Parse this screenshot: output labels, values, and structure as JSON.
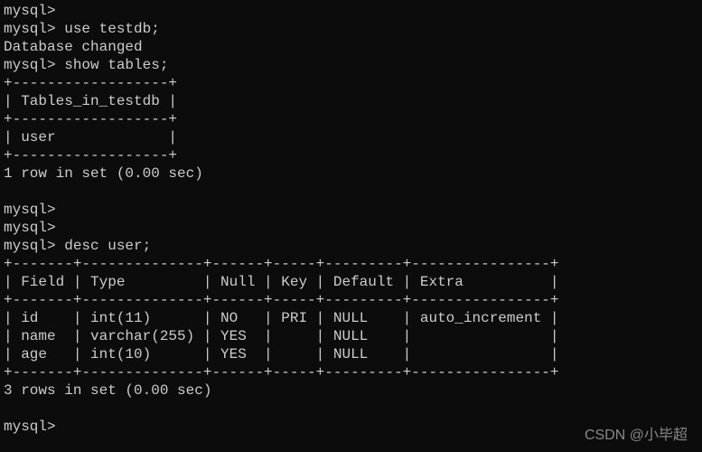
{
  "prompt": "mysql>",
  "commands": {
    "use_db": "use testdb;",
    "show_tables": "show tables;",
    "desc_user": "desc user;"
  },
  "messages": {
    "db_changed": "Database changed",
    "one_row": "1 row in set (0.00 sec)",
    "three_rows": "3 rows in set (0.00 sec)"
  },
  "tables_result": {
    "border_top": "+------------------+",
    "header": "| Tables_in_testdb |",
    "border_mid": "+------------------+",
    "row": "| user             |",
    "border_bot": "+------------------+"
  },
  "desc_result": {
    "border": "+-------+--------------+------+-----+---------+----------------+",
    "header": "| Field | Type         | Null | Key | Default | Extra          |",
    "row1": "| id    | int(11)      | NO   | PRI | NULL    | auto_increment |",
    "row2": "| name  | varchar(255) | YES  |     | NULL    |                |",
    "row3": "| age   | int(10)      | YES  |     | NULL    |                |"
  },
  "watermark": "CSDN @小毕超",
  "chart_data": {
    "type": "table",
    "tables_in_testdb": [
      "user"
    ],
    "desc_user": {
      "columns": [
        "Field",
        "Type",
        "Null",
        "Key",
        "Default",
        "Extra"
      ],
      "rows": [
        {
          "Field": "id",
          "Type": "int(11)",
          "Null": "NO",
          "Key": "PRI",
          "Default": "NULL",
          "Extra": "auto_increment"
        },
        {
          "Field": "name",
          "Type": "varchar(255)",
          "Null": "YES",
          "Key": "",
          "Default": "NULL",
          "Extra": ""
        },
        {
          "Field": "age",
          "Type": "int(10)",
          "Null": "YES",
          "Key": "",
          "Default": "NULL",
          "Extra": ""
        }
      ]
    }
  }
}
